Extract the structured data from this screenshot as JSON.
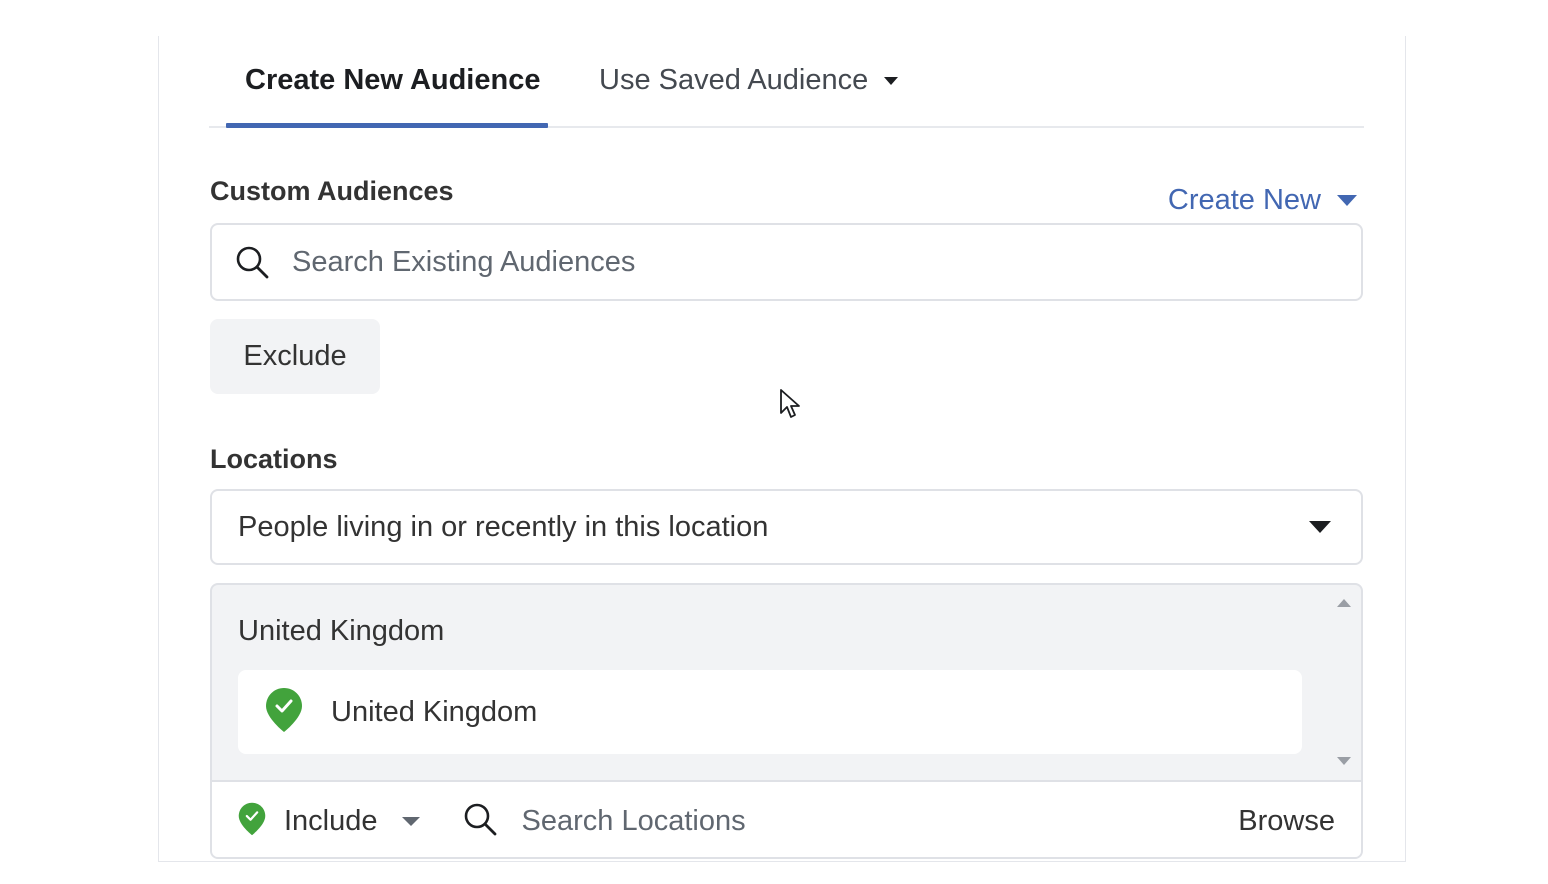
{
  "tabs": {
    "create_new": "Create New Audience",
    "use_saved": "Use Saved Audience"
  },
  "custom_audiences": {
    "title": "Custom Audiences",
    "create_new": "Create New",
    "search_placeholder": "Search Existing Audiences",
    "exclude": "Exclude"
  },
  "locations": {
    "title": "Locations",
    "type_select": "People living in or recently in this location",
    "group_label": "United Kingdom",
    "items": [
      {
        "name": "United Kingdom",
        "icon": "location-pin-check-icon"
      }
    ],
    "include_label": "Include",
    "search_placeholder": "Search Locations",
    "browse": "Browse"
  },
  "colors": {
    "accent": "#4267b2",
    "pin_green": "#42a33c",
    "panel_grey": "#f2f3f5"
  }
}
